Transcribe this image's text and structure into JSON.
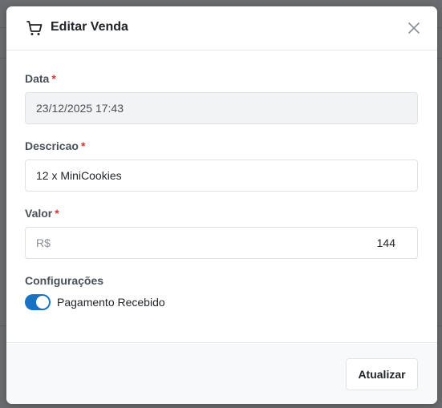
{
  "modal": {
    "title": "Editar Venda",
    "header_icon": "shopping-cart-icon",
    "close_icon": "close-icon"
  },
  "form": {
    "date": {
      "label": "Data",
      "required_mark": "*",
      "value": "23/12/2025 17:43",
      "disabled": true
    },
    "description": {
      "label": "Descricao",
      "required_mark": "*",
      "value": "12 x MiniCookies"
    },
    "value": {
      "label": "Valor",
      "required_mark": "*",
      "prefix": "R$",
      "amount": "144"
    },
    "settings": {
      "label": "Configurações",
      "toggle_label": "Pagamento Recebido",
      "toggle_on": true
    }
  },
  "footer": {
    "update_label": "Atualizar"
  },
  "colors": {
    "accent": "#1971c2",
    "required": "#e03131",
    "disabled_bg": "#f1f3f5"
  }
}
